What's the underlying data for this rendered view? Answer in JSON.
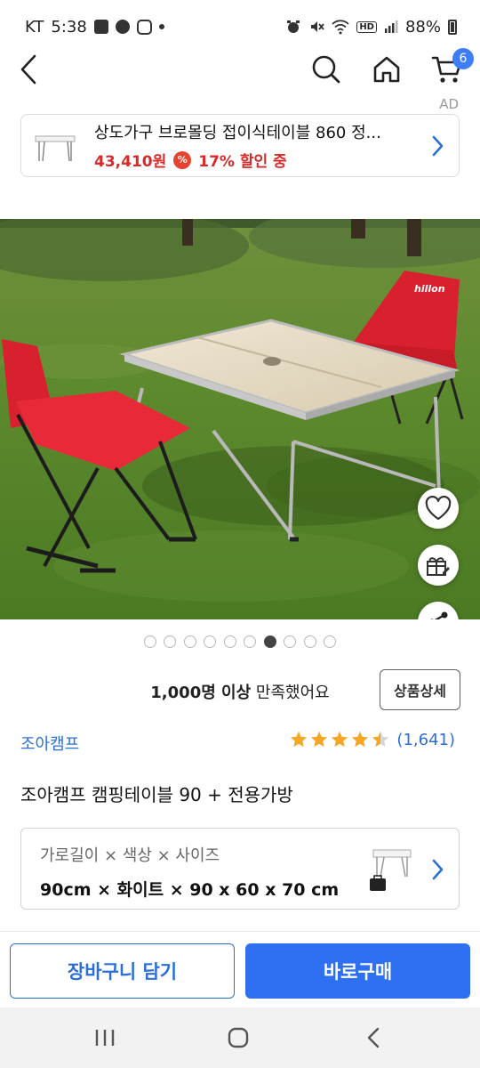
{
  "status_bar": {
    "carrier": "KT",
    "time": "5:38",
    "network": "HD",
    "battery": "88%"
  },
  "nav": {
    "cart_count": "6"
  },
  "ad": {
    "label": "AD",
    "title": "상도가구 브로몰딩 접이식테이블 860 정...",
    "price": "43,410원",
    "discount_icon": "%",
    "discount": "17% 할인 중"
  },
  "gallery": {
    "brand_on_chair": "hillon",
    "page_count": 10,
    "active_index": 7
  },
  "satisfaction": {
    "count_text": "1,000명 이상",
    "suffix": "만족했어요"
  },
  "detail_button": "상품상세",
  "product": {
    "brand": "조아캠프",
    "rating": 4.5,
    "review_count": "(1,641)",
    "title": "조아캠프 캠핑테이블 90 + 전용가방"
  },
  "option": {
    "label": "가로길이 × 색상 × 사이즈",
    "value": "90cm × 화이트 × 90 x 60 x 70 cm"
  },
  "actions": {
    "cart": "장바구니 담기",
    "buy": "바로구매"
  },
  "colors": {
    "accent": "#2f6ff2",
    "link": "#2b6fd8",
    "price_red": "#d92a2a",
    "star": "#f5a623"
  }
}
